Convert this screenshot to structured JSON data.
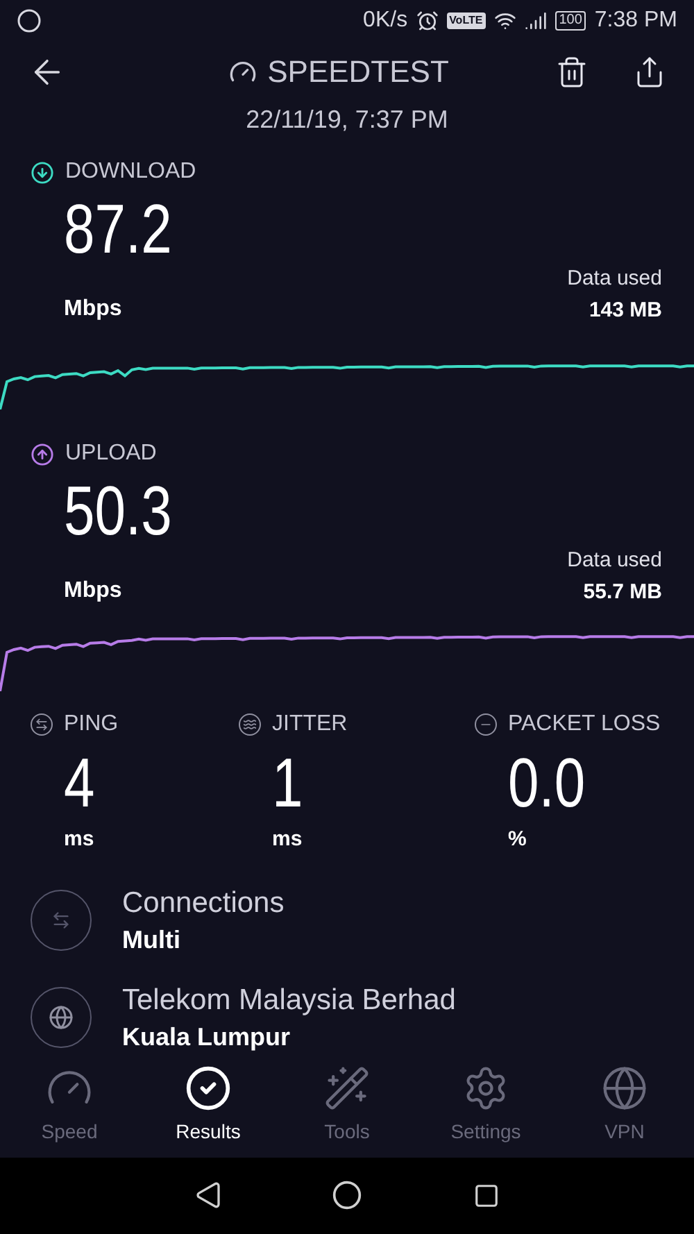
{
  "status_bar": {
    "speed": "0K/s",
    "volte": "VoLTE",
    "battery": "100",
    "time": "7:38 PM"
  },
  "header": {
    "title": "SPEEDTEST",
    "date": "22/11/19, 7:37 PM"
  },
  "tests": [
    {
      "kind": "download",
      "label": "DOWNLOAD",
      "value": "87.2",
      "unit": "Mbps",
      "data_label": "Data used",
      "data_value": "143 MB",
      "color": "#3ddbc3"
    },
    {
      "kind": "upload",
      "label": "UPLOAD",
      "value": "50.3",
      "unit": "Mbps",
      "data_label": "Data used",
      "data_value": "55.7 MB",
      "color": "#b77ce8"
    }
  ],
  "metrics": [
    {
      "kind": "ping",
      "label": "PING",
      "value": "4",
      "unit": "ms"
    },
    {
      "kind": "jitter",
      "label": "JITTER",
      "value": "1",
      "unit": "ms"
    },
    {
      "kind": "packet_loss",
      "label": "PACKET LOSS",
      "value": "0.0",
      "unit": "%"
    }
  ],
  "details": [
    {
      "kind": "connections",
      "title": "Connections",
      "value": "Multi"
    },
    {
      "kind": "server",
      "title": "Telekom Malaysia Berhad",
      "value": "Kuala Lumpur"
    }
  ],
  "tabs": [
    {
      "kind": "speed",
      "label": "Speed",
      "selected": false
    },
    {
      "kind": "results",
      "label": "Results",
      "selected": true
    },
    {
      "kind": "tools",
      "label": "Tools",
      "selected": false
    },
    {
      "kind": "settings",
      "label": "Settings",
      "selected": false
    },
    {
      "kind": "vpn",
      "label": "VPN",
      "selected": false
    }
  ]
}
